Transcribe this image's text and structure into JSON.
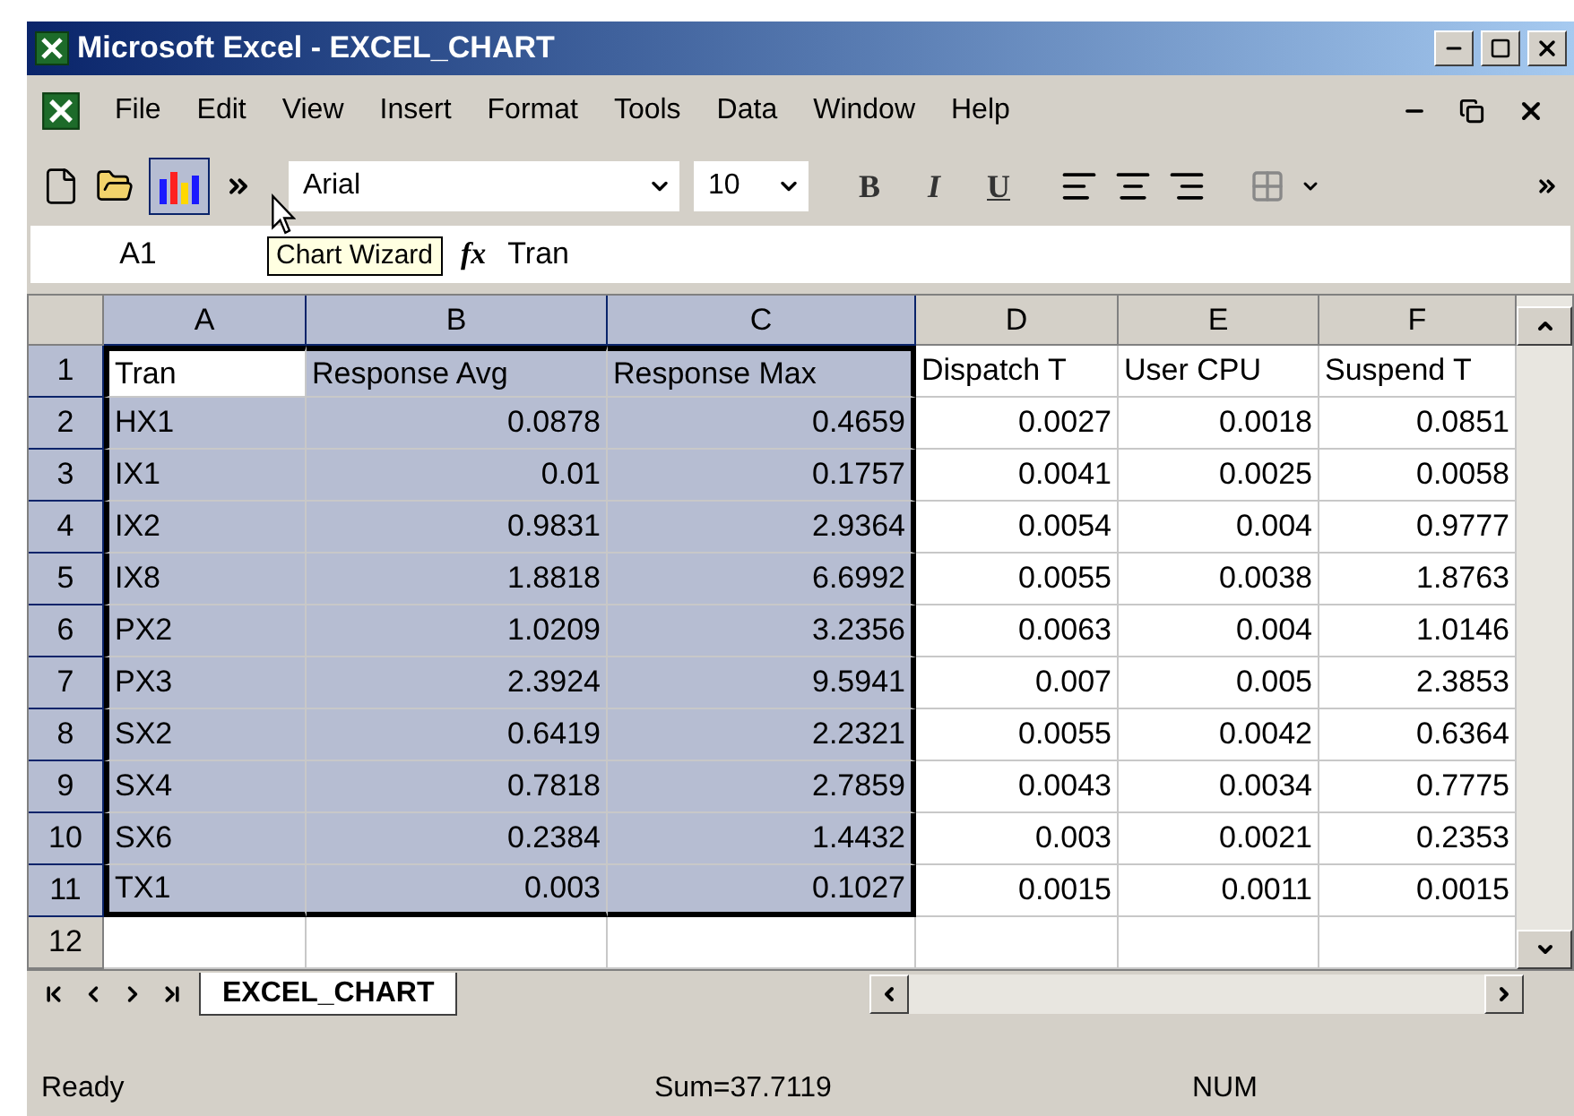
{
  "window": {
    "title": "Microsoft Excel - EXCEL_CHART"
  },
  "menu": [
    "File",
    "Edit",
    "View",
    "Insert",
    "Format",
    "Tools",
    "Data",
    "Window",
    "Help"
  ],
  "toolbar": {
    "chart_wizard_pressed": true,
    "font": "Arial",
    "size": "10",
    "bold": "B",
    "italic": "I",
    "underline": "U",
    "tooltip": "Chart Wizard"
  },
  "formula_bar": {
    "name_box": "A1",
    "fx": "fx",
    "value": "Tran"
  },
  "columns": [
    {
      "label": "A",
      "kind": "text",
      "selected": true,
      "active": true
    },
    {
      "label": "B",
      "kind": "number",
      "selected": true,
      "active": false
    },
    {
      "label": "C",
      "kind": "number",
      "selected": true,
      "active": false
    },
    {
      "label": "D",
      "kind": "number",
      "selected": false,
      "active": false
    },
    {
      "label": "E",
      "kind": "number",
      "selected": false,
      "active": false
    },
    {
      "label": "F",
      "kind": "number",
      "selected": false,
      "active": false
    }
  ],
  "rows": [
    {
      "label": "1",
      "kind": "header",
      "selected": true,
      "active": true,
      "cells": [
        "Tran",
        "Response Avg",
        "Response Max",
        "Dispatch T",
        "User CPU",
        "Suspend T"
      ]
    },
    {
      "label": "2",
      "kind": "data",
      "selected": true,
      "active": false,
      "cells": [
        "HX1",
        "0.0878",
        "0.4659",
        "0.0027",
        "0.0018",
        "0.0851"
      ]
    },
    {
      "label": "3",
      "kind": "data",
      "selected": true,
      "active": false,
      "cells": [
        "IX1",
        "0.01",
        "0.1757",
        "0.0041",
        "0.0025",
        "0.0058"
      ]
    },
    {
      "label": "4",
      "kind": "data",
      "selected": true,
      "active": false,
      "cells": [
        "IX2",
        "0.9831",
        "2.9364",
        "0.0054",
        "0.004",
        "0.9777"
      ]
    },
    {
      "label": "5",
      "kind": "data",
      "selected": true,
      "active": false,
      "cells": [
        "IX8",
        "1.8818",
        "6.6992",
        "0.0055",
        "0.0038",
        "1.8763"
      ]
    },
    {
      "label": "6",
      "kind": "data",
      "selected": true,
      "active": false,
      "cells": [
        "PX2",
        "1.0209",
        "3.2356",
        "0.0063",
        "0.004",
        "1.0146"
      ]
    },
    {
      "label": "7",
      "kind": "data",
      "selected": true,
      "active": false,
      "cells": [
        "PX3",
        "2.3924",
        "9.5941",
        "0.007",
        "0.005",
        "2.3853"
      ]
    },
    {
      "label": "8",
      "kind": "data",
      "selected": true,
      "active": false,
      "cells": [
        "SX2",
        "0.6419",
        "2.2321",
        "0.0055",
        "0.0042",
        "0.6364"
      ]
    },
    {
      "label": "9",
      "kind": "data",
      "selected": true,
      "active": false,
      "cells": [
        "SX4",
        "0.7818",
        "2.7859",
        "0.0043",
        "0.0034",
        "0.7775"
      ]
    },
    {
      "label": "10",
      "kind": "data",
      "selected": true,
      "active": false,
      "cells": [
        "SX6",
        "0.2384",
        "1.4432",
        "0.003",
        "0.0021",
        "0.2353"
      ]
    },
    {
      "label": "11",
      "kind": "data",
      "selected": true,
      "active": false,
      "cells": [
        "TX1",
        "0.003",
        "0.1027",
        "0.0015",
        "0.0011",
        "0.0015"
      ]
    },
    {
      "label": "12",
      "kind": "data",
      "selected": false,
      "active": false
    }
  ],
  "sheet_tabs": [
    {
      "label": "EXCEL_CHART",
      "selected": true
    }
  ],
  "status_bar": {
    "status": "Ready",
    "sum": "Sum=37.7119",
    "mode": "NUM"
  }
}
